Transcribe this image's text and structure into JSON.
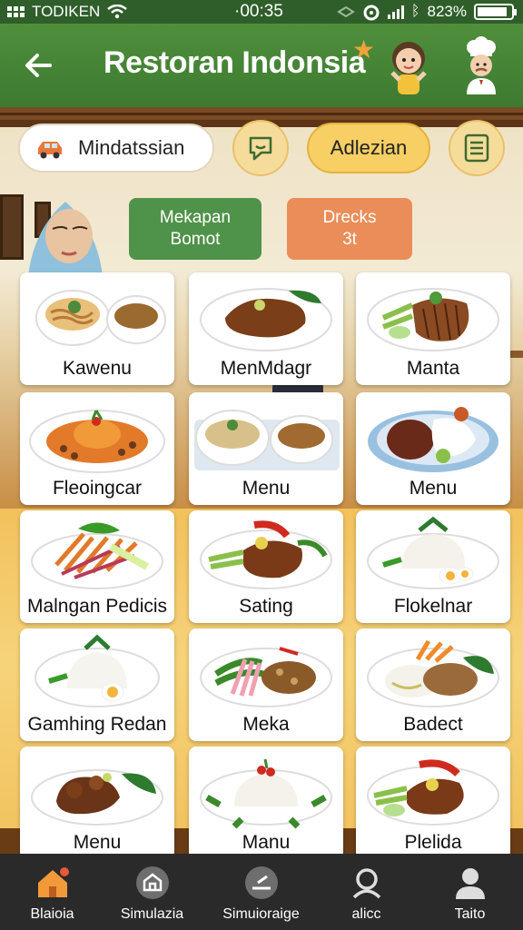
{
  "status_bar": {
    "carrier": "TODIKEN",
    "time": "·00:35",
    "battery": "823%"
  },
  "header": {
    "title": "Restoran Indonsia"
  },
  "search": {
    "value": "Mindatssian"
  },
  "filter": {
    "label": "Adlezian"
  },
  "tags": {
    "green": [
      "Mekapan",
      "Bomot"
    ],
    "orange": [
      "Drecks",
      "3t"
    ]
  },
  "menu": {
    "items": [
      {
        "label": "Kawenu",
        "food": "noodles"
      },
      {
        "label": "MenMdagr",
        "food": "meat"
      },
      {
        "label": "Manta",
        "food": "grill"
      },
      {
        "label": "Fleoingcar",
        "food": "rice-orange"
      },
      {
        "label": "Menu",
        "food": "bowls"
      },
      {
        "label": "Menu",
        "food": "rendang"
      },
      {
        "label": "Malngan Pedicis",
        "food": "salad"
      },
      {
        "label": "Sating",
        "food": "chicken"
      },
      {
        "label": "Flokelnar",
        "food": "rice-egg"
      },
      {
        "label": "Gamhing Redan",
        "food": "rice-egg2"
      },
      {
        "label": "Meka",
        "food": "satay-veg"
      },
      {
        "label": "Badect",
        "food": "mixed"
      },
      {
        "label": "Menu",
        "food": "beef"
      },
      {
        "label": "Manu",
        "food": "rice-white"
      },
      {
        "label": "Plelida",
        "food": "chicken2"
      }
    ]
  },
  "nav": {
    "items": [
      {
        "label": "Blaioia",
        "icon": "home-icon"
      },
      {
        "label": "Simulazia",
        "icon": "store-icon"
      },
      {
        "label": "Simuioraige",
        "icon": "plate-icon"
      },
      {
        "label": "alicc",
        "icon": "search-person-icon"
      },
      {
        "label": "Taito",
        "icon": "person-icon"
      }
    ]
  },
  "colors": {
    "header": "#4f8f3c",
    "status": "#2f5e2a",
    "accent": "#f7cf64",
    "nav": "#2a2a2a"
  }
}
